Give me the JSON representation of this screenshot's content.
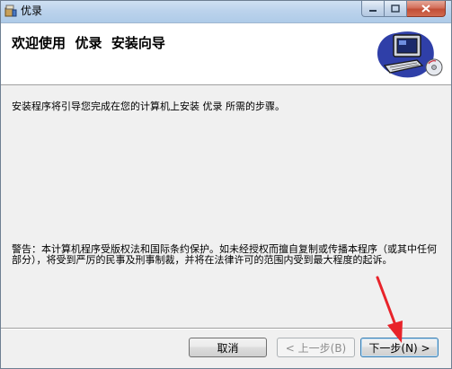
{
  "window": {
    "title": "优录",
    "icon": "installer-package-icon",
    "controls": {
      "minimize": "minimize-icon",
      "maximize": "maximize-icon",
      "close": "close-icon"
    }
  },
  "header": {
    "title": "欢迎使用  优录  安装向导",
    "graphic": "computer-installer-graphic"
  },
  "body": {
    "intro": "安装程序将引导您完成在您的计算机上安装 优录 所需的步骤。",
    "warning": "警告：本计算机程序受版权法和国际条约保护。如未经授权而擅自复制或传播本程序（或其中任何部分），将受到严厉的民事及刑事制裁，并将在法律许可的范围内受到最大程度的起诉。"
  },
  "buttons": {
    "cancel": "取消",
    "back": "< 上一步(B)",
    "next": "下一步(N) >"
  },
  "colors": {
    "annotation_arrow": "#e8232a",
    "dialog_background": "#f0f0f0"
  }
}
